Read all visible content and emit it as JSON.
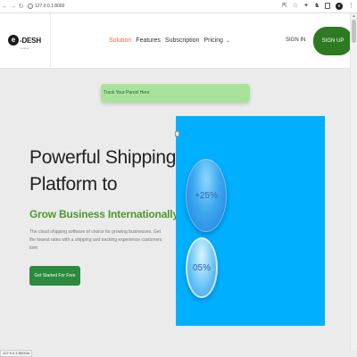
{
  "browser": {
    "url": "127.0.0.1:8000",
    "back_icon": "arrow-left",
    "forward_icon": "arrow-right",
    "reload_icon": "reload"
  },
  "header": {
    "logo_mark": "e",
    "logo_text": "-DESH",
    "logo_subtext": "▪▪ ▪▪▪ ▪▪",
    "nav": [
      {
        "label": "Solution",
        "active": true
      },
      {
        "label": "Features",
        "active": false
      },
      {
        "label": "Subscription",
        "active": false
      },
      {
        "label": "Pricing",
        "active": false,
        "dropdown": true
      }
    ],
    "signin_label": "SIGN IN",
    "signup_label": "SIGN UP"
  },
  "hero": {
    "track_placeholder": "Track Your Parcel Here",
    "headline_line1": "Powerful Shipping",
    "headline_line2": "Platform to",
    "subheadline": "Grow Business Internationally",
    "description": "The cloud shipping software of choice for growing businesses. Get the lowest rates with a shipping and tracking experience customers love.",
    "cta_label": "Get Started For Free",
    "stat_1": "+25%",
    "stat_2": "05%"
  },
  "status_bar": {
    "text": "127.0.0.1:8000/#"
  },
  "colors": {
    "accent_orange": "#ef6a3a",
    "brand_green": "#2d7a22",
    "subhead_green": "#4a9a2c",
    "panel_blue": "#00b0ff",
    "track_green": "#a9e29a"
  }
}
